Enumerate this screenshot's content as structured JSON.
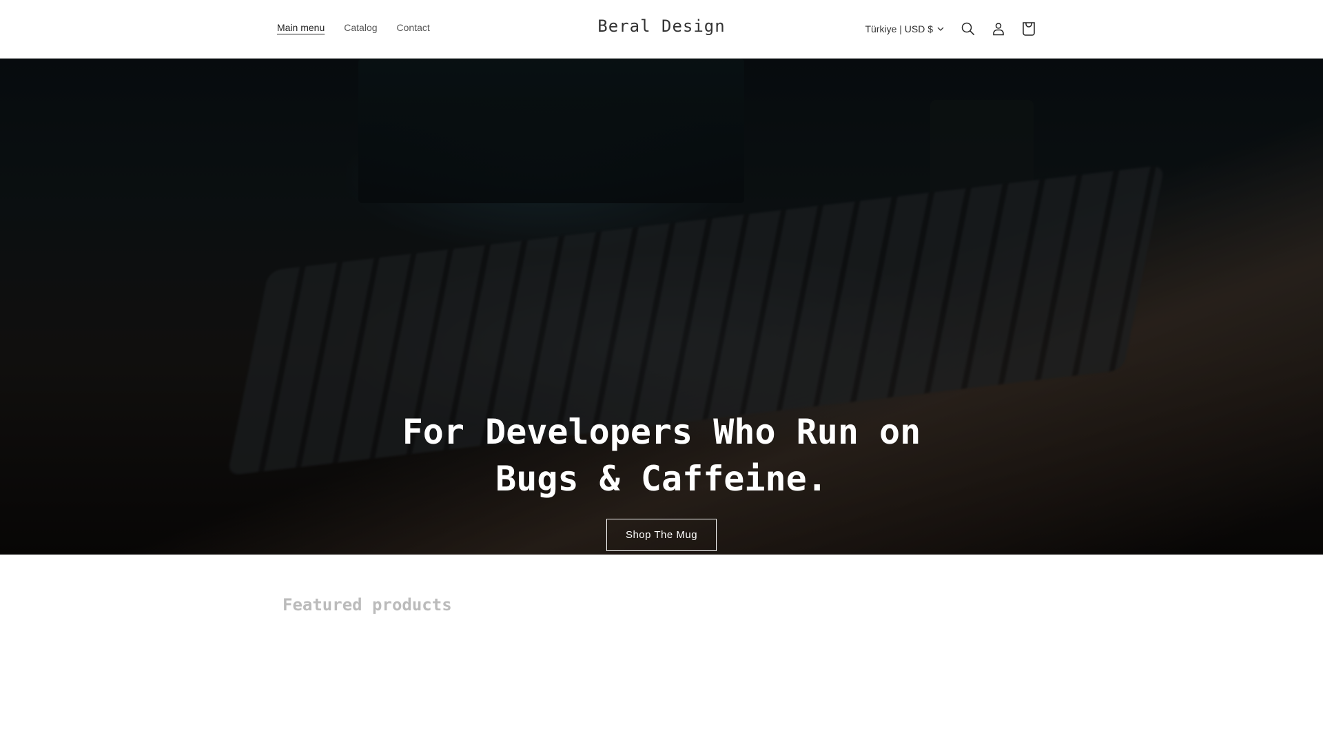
{
  "header": {
    "nav": [
      "Main menu",
      "Catalog",
      "Contact"
    ],
    "logo": "Beral Design",
    "locale": "Türkiye | USD $",
    "icons": [
      "search-icon",
      "account-icon",
      "cart-icon"
    ]
  },
  "hero": {
    "title_line1": "For Developers Who Run on",
    "title_line2": "Bugs & Caffeine.",
    "cta": "Shop The Mug"
  },
  "featured": {
    "heading": "Featured products"
  }
}
